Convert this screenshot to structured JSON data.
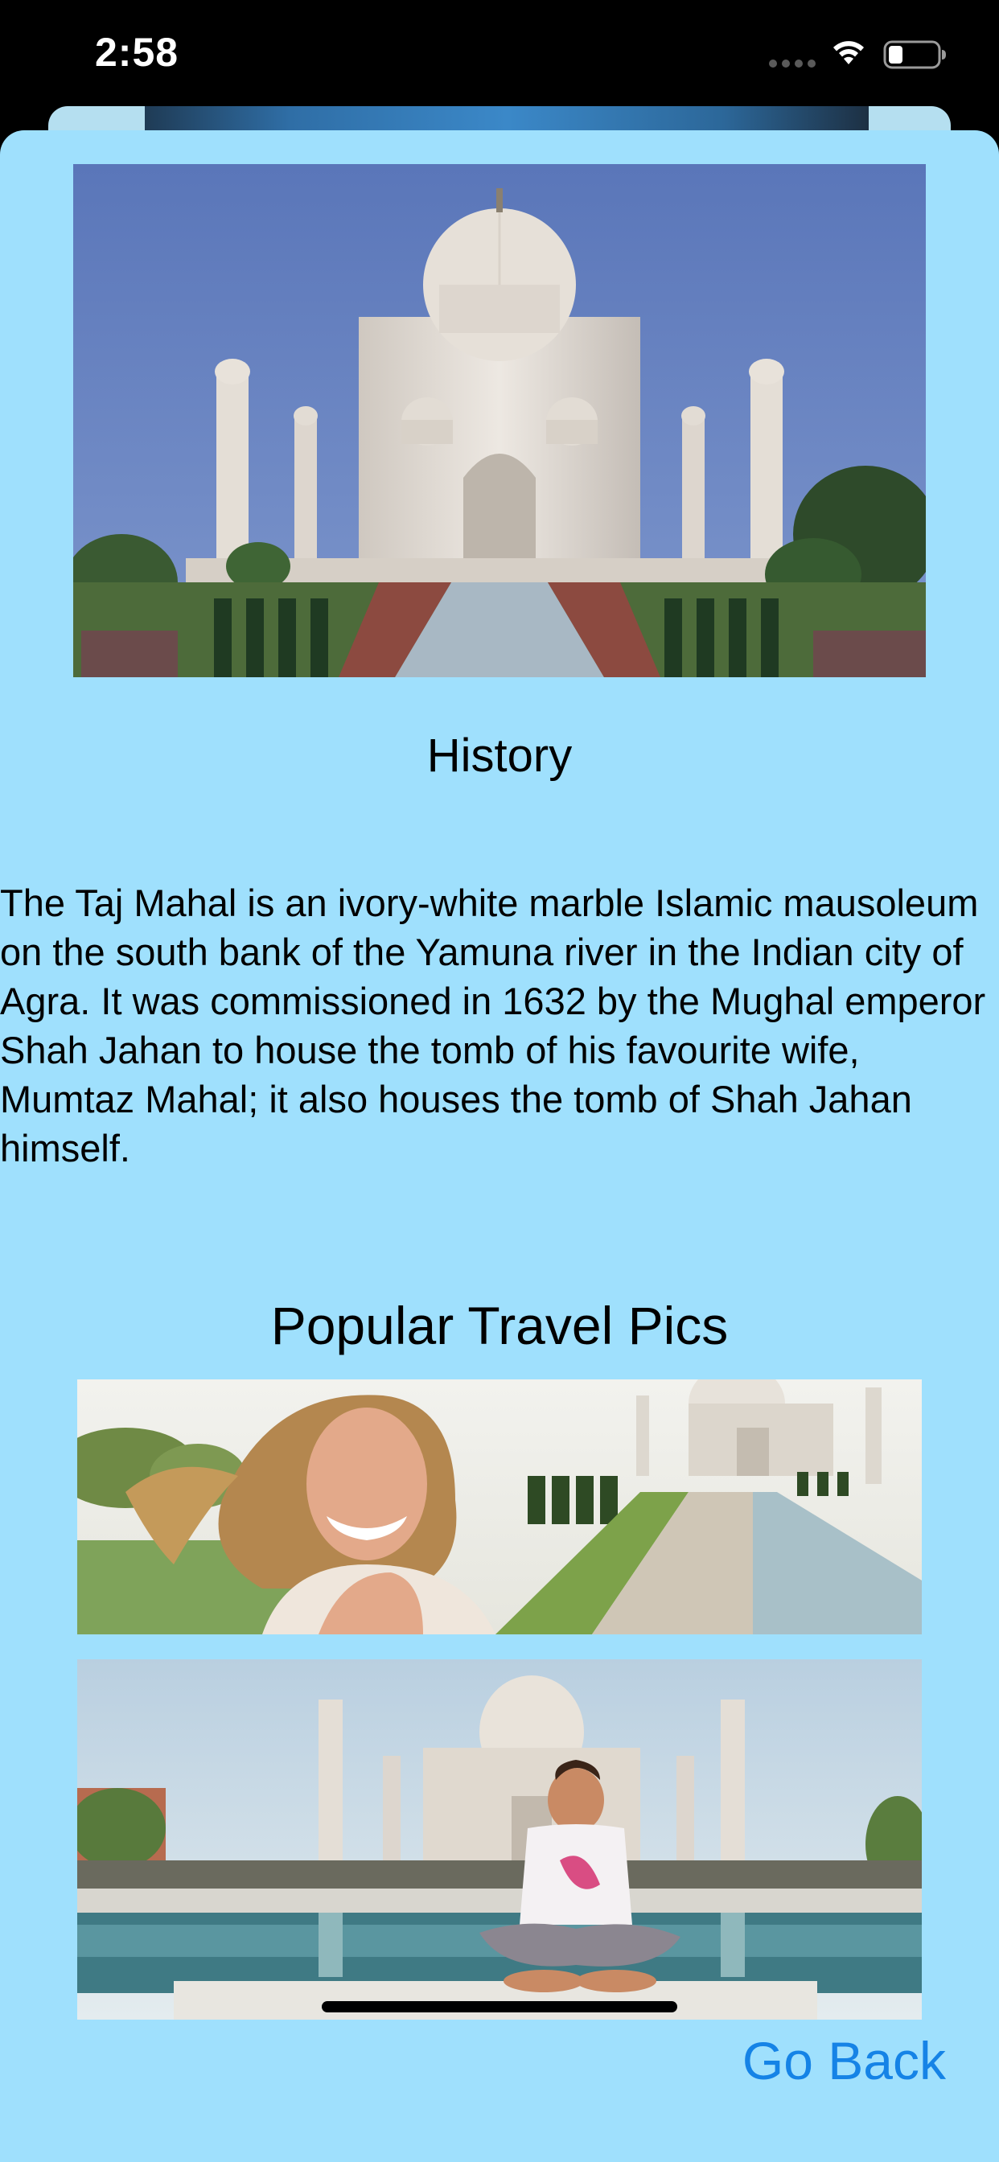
{
  "status_bar": {
    "time": "2:58",
    "signal_icon": "cellular-dots-icon",
    "wifi_icon": "wifi-icon",
    "battery_icon": "battery-icon",
    "battery_level": 0.25
  },
  "hero": {
    "image": "taj-mahal-photo"
  },
  "history": {
    "title": "History",
    "text": "The Taj Mahal is an ivory-white marble Islamic mausoleum on the south bank of the Yamuna river in the Indian city of Agra. It was commissioned in 1632 by the Mughal emperor Shah Jahan to house the tomb of his favourite wife, Mumtaz Mahal; it also houses the tomb of Shah Jahan himself."
  },
  "popular": {
    "title": "Popular Travel Pics",
    "pics": [
      {
        "image": "woman-laughing-at-taj-mahal-photo"
      },
      {
        "image": "woman-sitting-before-taj-mahal-photo"
      }
    ]
  },
  "actions": {
    "go_back": "Go Back"
  },
  "colors": {
    "background": "#9fe0fd",
    "link": "#1583e6",
    "status_bar": "#000000"
  }
}
